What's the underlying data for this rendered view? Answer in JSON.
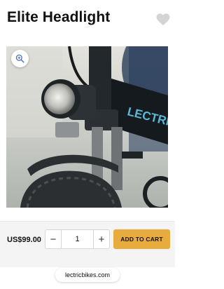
{
  "product": {
    "title": "Elite Headlight",
    "price": "US$99.00",
    "quantity": "1"
  },
  "gallery": {
    "image_alt": "Elite headlight mounted on a Lectric e-bike",
    "frame_brand": "LECTRIC"
  },
  "buttons": {
    "add_to_cart": "ADD TO CART",
    "minus": "−",
    "plus": "+"
  },
  "browser": {
    "url": "lectricbikes.com"
  },
  "colors": {
    "accent": "#e8ac3e",
    "frame": "#141a1e",
    "frame_text": "#5bb8d8"
  },
  "icons": {
    "wishlist": "heart-icon",
    "zoom": "zoom-in-icon"
  }
}
